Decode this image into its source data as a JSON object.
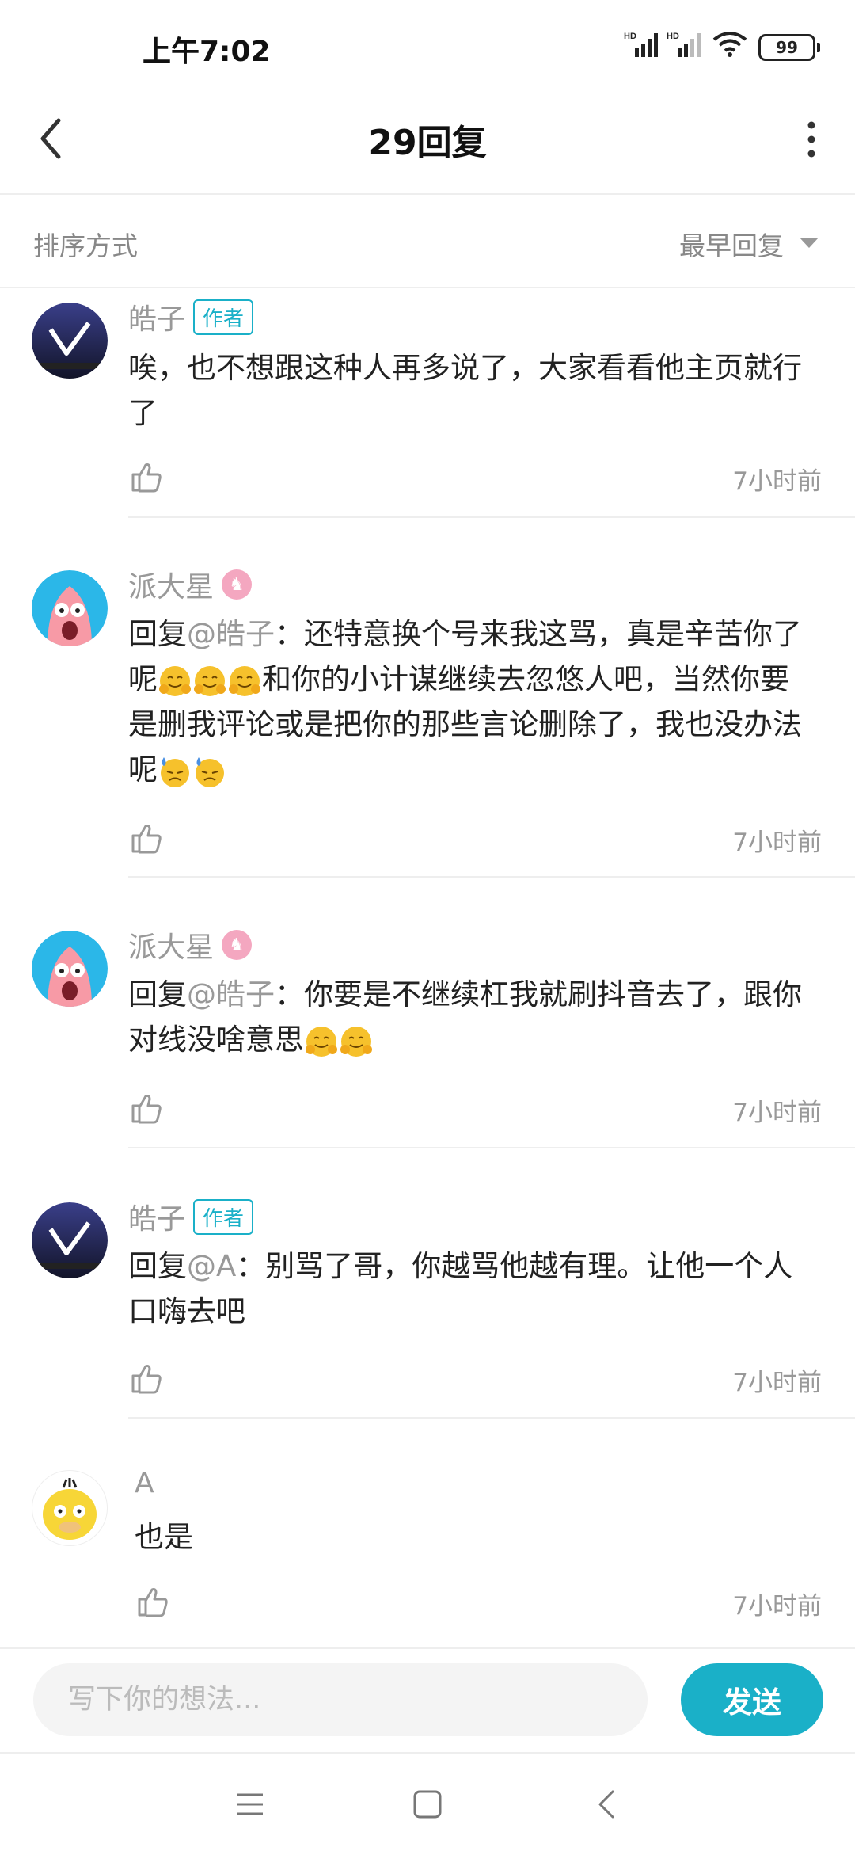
{
  "status_bar": {
    "time": "上午7:02",
    "network_1": "HD",
    "network_2": "HD",
    "battery": "99"
  },
  "header": {
    "title": "29回复"
  },
  "sort": {
    "label": "排序方式",
    "value": "最早回复"
  },
  "comments": [
    {
      "name": "皓子",
      "tag": "作者",
      "text": "唉，也不想跟这种人再多说了，大家看看他主页就行了",
      "time": "7小时前"
    },
    {
      "name": "派大星",
      "reply_prefix": "回复",
      "mention": "@皓子",
      "text_part1": "：还特意换个号来我这骂，真是辛苦你了呢",
      "text_part2": "和你的小计谋继续去忽悠人吧，当然你要是删我评论或是把你的那些言论删除了，我也没办法呢",
      "time": "7小时前"
    },
    {
      "name": "派大星",
      "reply_prefix": "回复",
      "mention": "@皓子",
      "text": "：你要是不继续杠我就刷抖音去了，跟你对线没啥意思",
      "time": "7小时前"
    },
    {
      "name": "皓子",
      "tag": "作者",
      "reply_prefix": "回复",
      "mention": "@A",
      "text": "：别骂了哥，你越骂他越有理。让他一个人口嗨去吧",
      "time": "7小时前"
    },
    {
      "name": "A",
      "text": "也是",
      "time": "7小时前"
    }
  ],
  "input": {
    "placeholder": "写下你的想法...",
    "send_label": "发送"
  },
  "colors": {
    "accent": "#1ab0c8",
    "secondary_text": "#999999"
  },
  "icons": [
    "back-arrow-icon",
    "more-vertical-icon",
    "caret-down-icon",
    "thumbs-up-icon",
    "hug-emoji-icon",
    "sweat-emoji-icon",
    "menu-icon",
    "home-square-icon",
    "back-triangle-icon"
  ]
}
